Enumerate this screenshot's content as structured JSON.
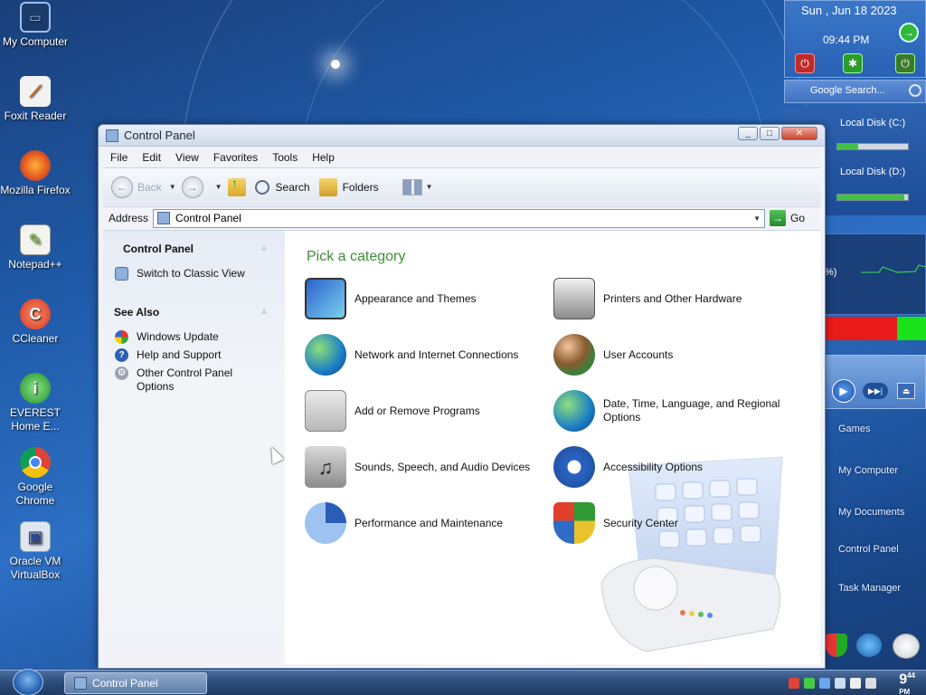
{
  "desktop": {
    "icons": [
      {
        "label": "My Computer"
      },
      {
        "label": "Foxit Reader"
      },
      {
        "label": "Mozilla Firefox"
      },
      {
        "label": "Notepad++"
      },
      {
        "label": "CCleaner"
      },
      {
        "label": "EVEREST Home E..."
      },
      {
        "label": "Google Chrome"
      },
      {
        "label": "Oracle VM VirtualBox"
      }
    ]
  },
  "sidebar": {
    "date": "Sun , Jun 18 2023",
    "time": "09:44 PM",
    "search_placeholder": "Google Search...",
    "disk_c": "Local Disk (C:)",
    "disk_d": "Local Disk (D:)",
    "disk_c_usage": 0.3,
    "disk_d_usage": 0.95,
    "cpu_text": "%)",
    "menu": [
      "Games",
      "My Computer",
      "My Documents",
      "Control Panel",
      "Task Manager"
    ]
  },
  "window": {
    "title": "Control Panel",
    "menu": [
      "File",
      "Edit",
      "View",
      "Favorites",
      "Tools",
      "Help"
    ],
    "toolbar": {
      "back": "Back",
      "search": "Search",
      "folders": "Folders"
    },
    "address": {
      "label": "Address",
      "value": "Control Panel",
      "go": "Go"
    },
    "left": {
      "panel_title": "Control Panel",
      "switch_view": "Switch to Classic View",
      "see_also_title": "See Also",
      "see_also": [
        "Windows Update",
        "Help and Support",
        "Other Control Panel Options"
      ]
    },
    "main": {
      "heading": "Pick a category",
      "categories": [
        "Appearance and Themes",
        "Printers and Other Hardware",
        "Network and Internet Connections",
        "User Accounts",
        "Add or Remove Programs",
        "Date, Time, Language, and Regional Options",
        "Sounds, Speech, and Audio Devices",
        "Accessibility Options",
        "Performance and Maintenance",
        "Security Center"
      ]
    }
  },
  "taskbar": {
    "task": "Control Panel",
    "clock_hour": "9",
    "clock_min": "44",
    "clock_ampm": "PM"
  }
}
